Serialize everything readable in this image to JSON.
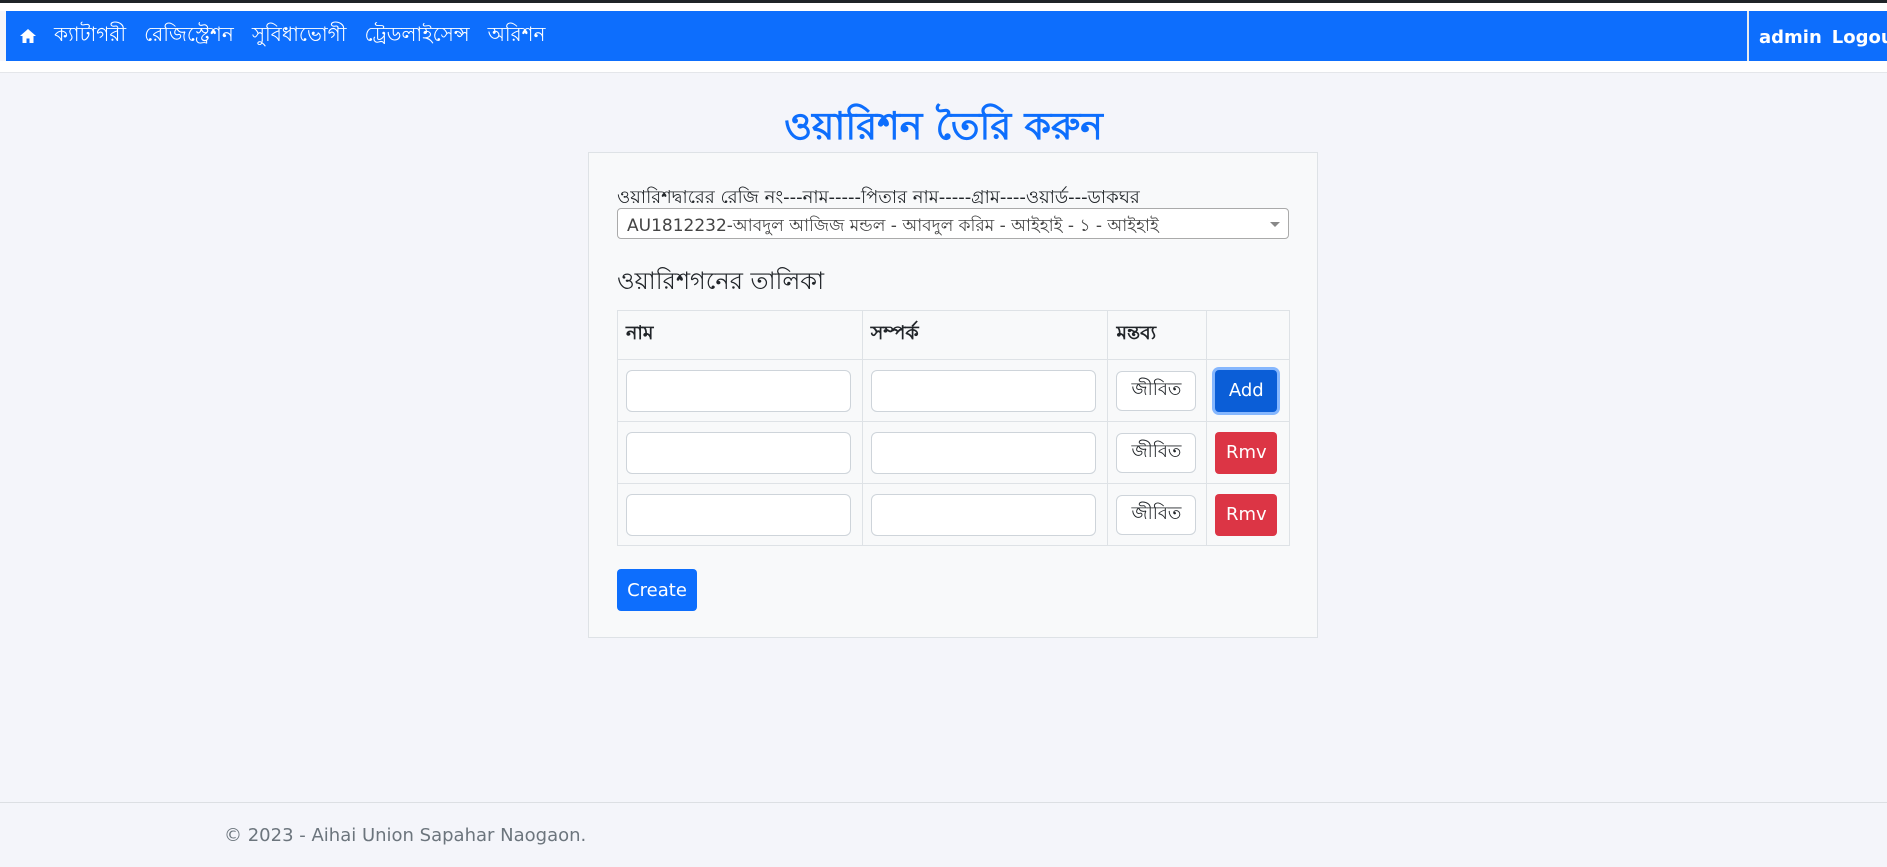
{
  "nav": {
    "home_icon": "home-icon",
    "links": [
      "ক্যাটাগরী",
      "রেজিস্ট্রেশন",
      "সুবিধাভোগী",
      "ট্রেডলাইসেন্স",
      "অরিশন"
    ],
    "user": "admin",
    "logout": "Logout"
  },
  "page": {
    "title": "ওয়ারিশন তৈরি করুন"
  },
  "form": {
    "select_label": "ওয়ারিশদ্বারের রেজি নং---নাম-----পিতার নাম-----গ্রাম----ওয়ার্ড---ডাকঘর",
    "selected_value": "AU1812232-আবদুল আজিজ মন্ডল - আবদুল করিম - আইহাই - ১ - আইহাই",
    "table_title": "ওয়ারিশগনের তালিকা",
    "columns": [
      "নাম",
      "সম্পর্ক",
      "মন্তব্য",
      ""
    ],
    "rows": [
      {
        "name": "",
        "relation": "",
        "status": "জীবিত",
        "action": "Add"
      },
      {
        "name": "",
        "relation": "",
        "status": "জীবিত",
        "action": "Rmv"
      },
      {
        "name": "",
        "relation": "",
        "status": "জীবিত",
        "action": "Rmv"
      }
    ],
    "create_label": "Create"
  },
  "footer": {
    "text": "© 2023 - Aihai Union Sapahar Naogaon."
  },
  "colors": {
    "primary": "#0d6efd",
    "danger": "#dc3545",
    "background": "#f4f5fa"
  }
}
